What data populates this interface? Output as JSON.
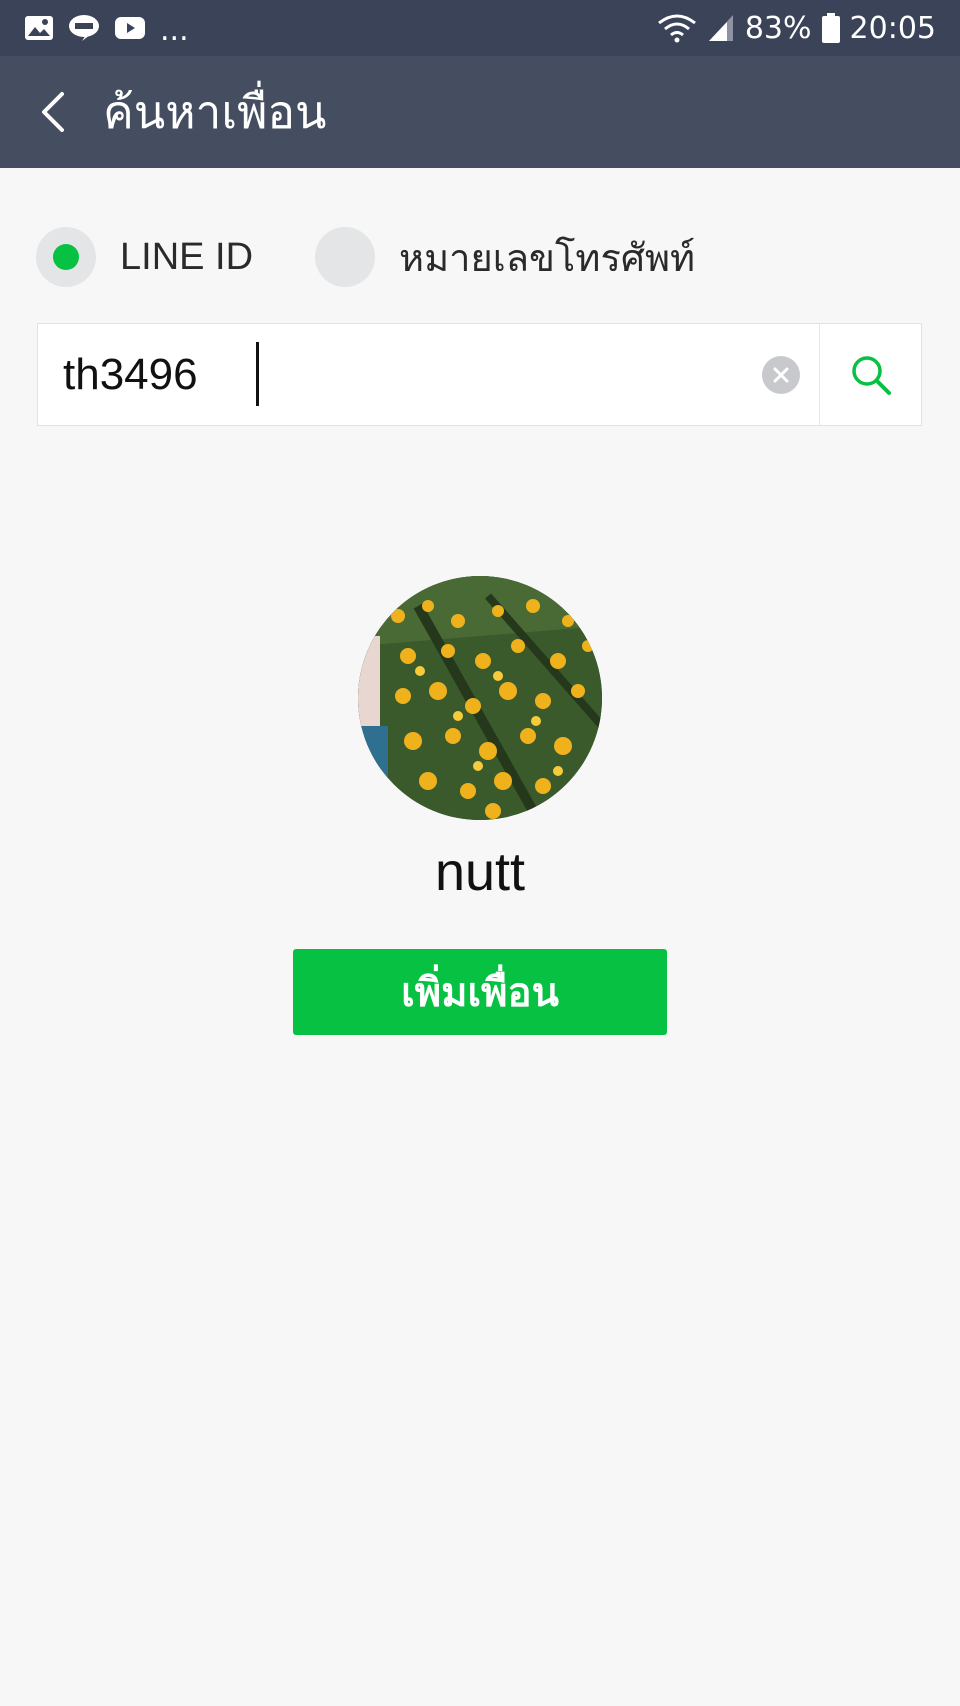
{
  "status_bar": {
    "notification_icons": [
      "gallery-icon",
      "line-app-icon",
      "youtube-icon"
    ],
    "more_indicator": "...",
    "battery": "83%",
    "time": "20:05"
  },
  "header": {
    "title": "ค้นหาเพื่อน"
  },
  "search_type": {
    "options": [
      {
        "label": "LINE ID",
        "selected": true
      },
      {
        "label": "หมายเลขโทรศัพท์",
        "selected": false
      }
    ]
  },
  "search": {
    "value": "th3496"
  },
  "result": {
    "name": "nutt",
    "add_button_label": "เพิ่มเพื่อน"
  },
  "colors": {
    "accent": "#06c142",
    "status_bar": "#3b4358",
    "app_bar": "#454e61",
    "background": "#f7f7f7"
  }
}
